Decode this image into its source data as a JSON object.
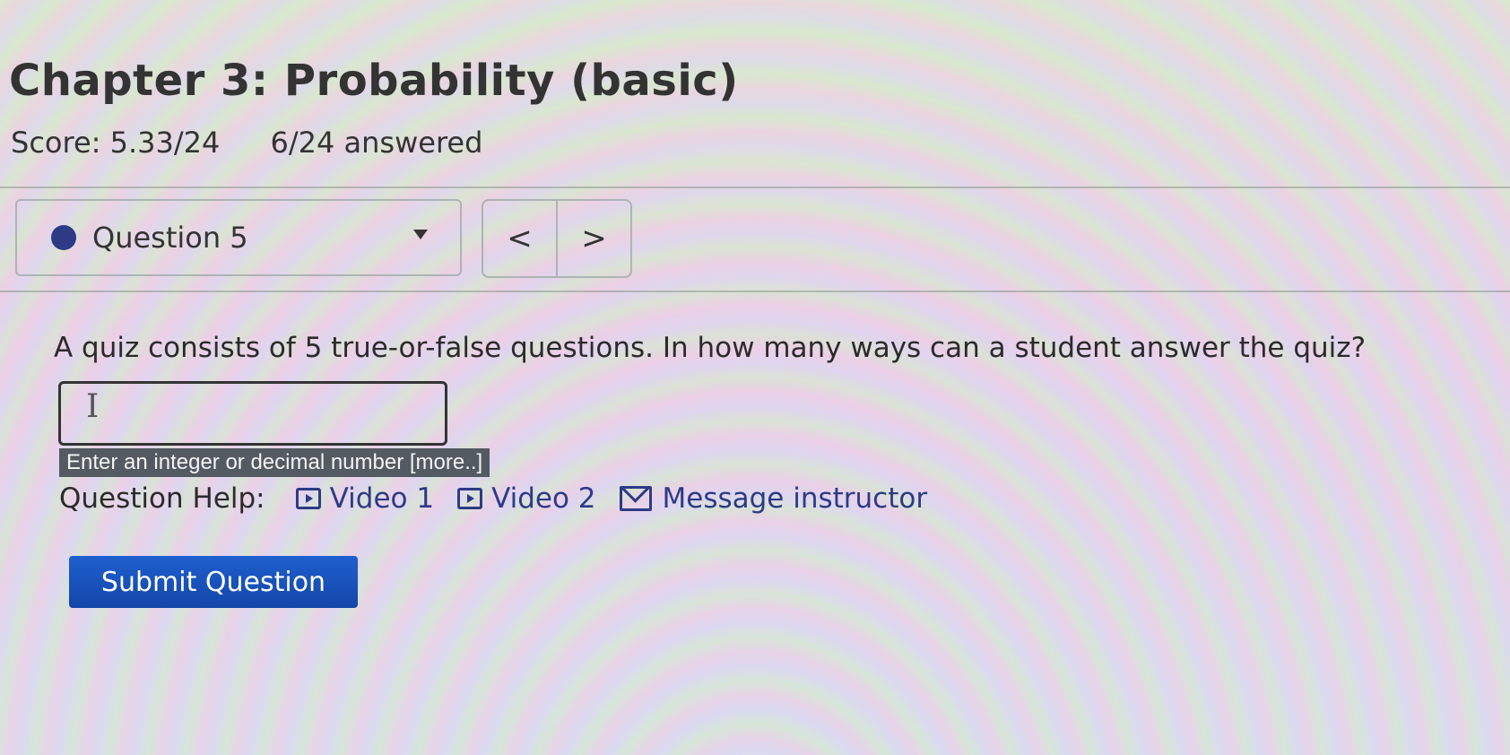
{
  "header": {
    "title": "Chapter 3: Probability (basic)",
    "score": "Score: 5.33/24",
    "answered": "6/24 answered"
  },
  "question_nav": {
    "selected_label": "Question 5",
    "prev_symbol": "<",
    "next_symbol": ">",
    "status_color": "#2d3a86"
  },
  "question": {
    "text": "A quiz consists of 5 true-or-false questions. In how many ways can a student answer the quiz?",
    "answer_value": "",
    "hint": "Enter an integer or decimal number",
    "hint_more": "[more..]"
  },
  "help": {
    "label": "Question Help:",
    "video1": "Video 1",
    "video2": "Video 2",
    "message": "Message instructor"
  },
  "actions": {
    "submit_label": "Submit Question",
    "submit_color": "#1a55c2"
  }
}
